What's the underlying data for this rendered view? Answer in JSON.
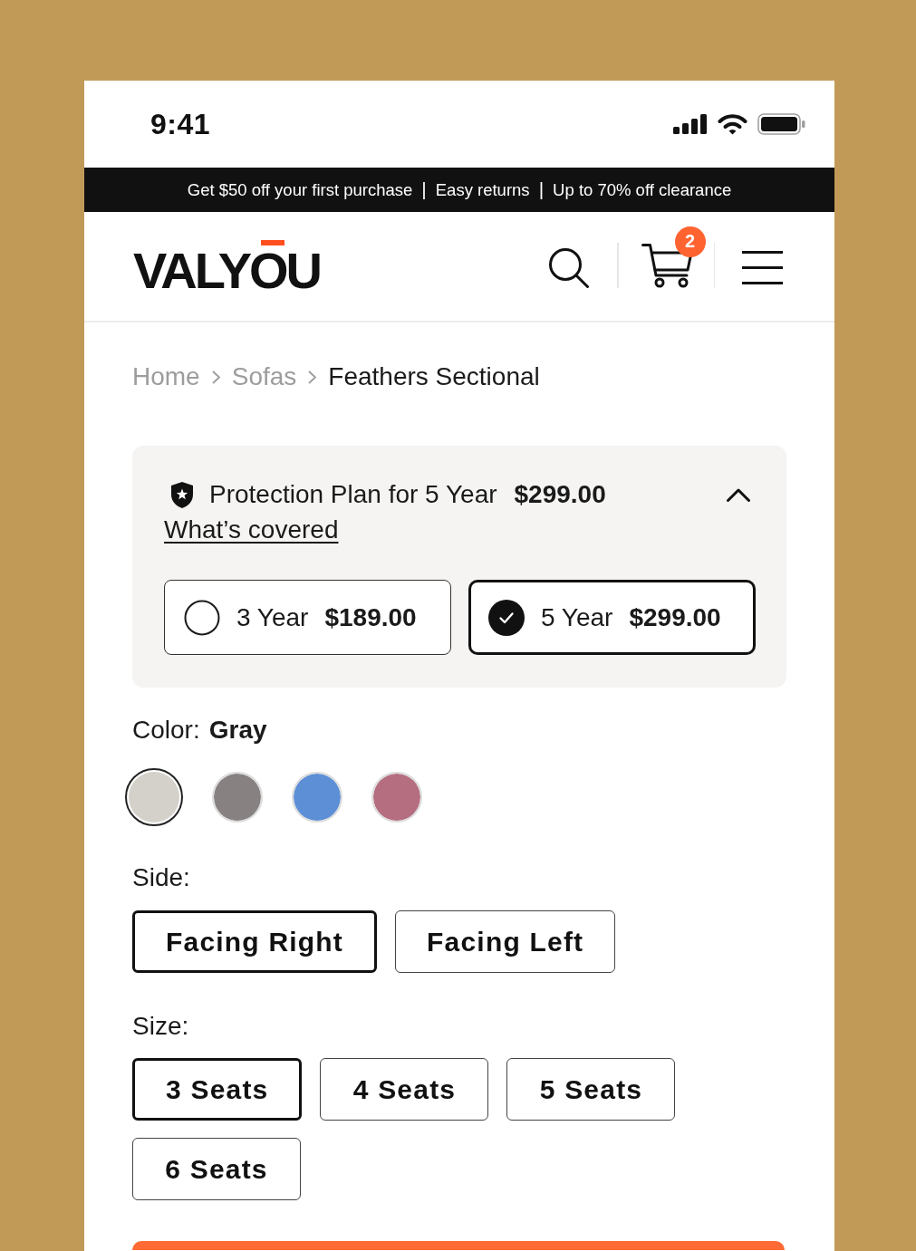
{
  "status_bar": {
    "time": "9:41"
  },
  "promo_bar": [
    {
      "kind": "offer",
      "text": "Get $50 off your first purchase"
    },
    {
      "kind": "separator",
      "text": "|"
    },
    {
      "kind": "offer",
      "text": "Easy returns"
    },
    {
      "kind": "separator",
      "text": "|"
    },
    {
      "kind": "offer",
      "text": "Up to 70% off clearance"
    }
  ],
  "header": {
    "logo": "VALYOU",
    "cart_count": "2"
  },
  "breadcrumb": [
    {
      "label": "Home",
      "current": false
    },
    {
      "label": "Sofas",
      "current": false
    },
    {
      "label": "Feathers Sectional",
      "current": true
    }
  ],
  "protection_plan": {
    "title": "Protection Plan for 5 Year",
    "price": "$299.00",
    "expanded": true,
    "link": "What’s covered",
    "options": [
      {
        "term": "3 Year",
        "price": "$189.00",
        "selected": false
      },
      {
        "term": "5 Year",
        "price": "$299.00",
        "selected": true
      }
    ]
  },
  "color": {
    "label": "Color:",
    "value": "Gray",
    "swatches": [
      {
        "color": "#d4d1cb",
        "selected": true
      },
      {
        "color": "#878281",
        "selected": false
      },
      {
        "color": "#5d8fd6",
        "selected": false
      },
      {
        "color": "#b56e80",
        "selected": false
      }
    ]
  },
  "side": {
    "label": "Side:",
    "options": [
      {
        "label": "Facing Right",
        "selected": true
      },
      {
        "label": "Facing Left",
        "selected": false
      }
    ]
  },
  "size": {
    "label": "Size:",
    "options": [
      {
        "label": "3 Seats",
        "selected": true
      },
      {
        "label": "4 Seats",
        "selected": false
      },
      {
        "label": "5 Seats",
        "selected": false
      },
      {
        "label": "6 Seats",
        "selected": false
      }
    ]
  }
}
